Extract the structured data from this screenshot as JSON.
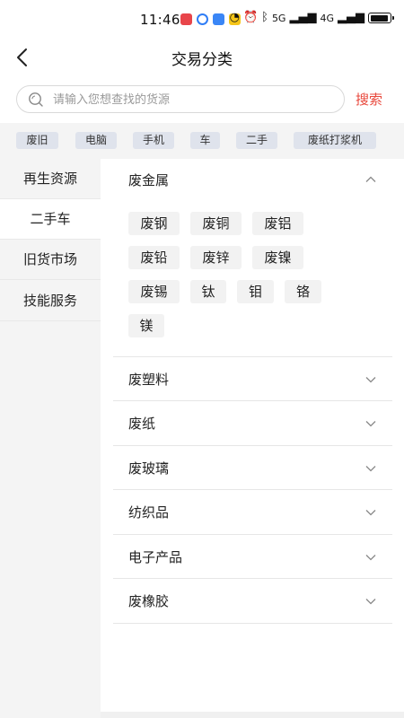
{
  "status": {
    "time": "11:46",
    "network": "5G",
    "network2": "4G",
    "app_icon_colors": [
      "#e8454a",
      "#2f7df6",
      "#3a86f6",
      "#f5c518"
    ]
  },
  "nav": {
    "title": "交易分类",
    "back_icon": "chevron-left-icon"
  },
  "search": {
    "placeholder": "请输入您想查找的货源",
    "value": "",
    "button_label": "搜索",
    "icon": "search-icon"
  },
  "hot_tags": [
    "废旧",
    "电脑",
    "手机",
    "车",
    "二手",
    "废纸打浆机"
  ],
  "sidebar": {
    "items": [
      {
        "label": "再生资源"
      },
      {
        "label": "二手车"
      },
      {
        "label": "旧货市场"
      },
      {
        "label": "技能服务"
      }
    ]
  },
  "categories": [
    {
      "title": "废金属",
      "expanded": true,
      "items": [
        "废钢",
        "废铜",
        "废铝",
        "废铅",
        "废锌",
        "废镍",
        "废锡",
        "钛",
        "钼",
        "铬",
        "镁"
      ]
    },
    {
      "title": "废塑料",
      "expanded": false
    },
    {
      "title": "废纸",
      "expanded": false
    },
    {
      "title": "废玻璃",
      "expanded": false
    },
    {
      "title": "纺织品",
      "expanded": false
    },
    {
      "title": "电子产品",
      "expanded": false
    },
    {
      "title": "废橡胶",
      "expanded": false
    }
  ],
  "colors": {
    "accent": "#e8483c",
    "tag_bg": "#dfe3ec",
    "sidebar_bg": "#f4f4f4",
    "chip_bg": "#f2f2f2"
  }
}
